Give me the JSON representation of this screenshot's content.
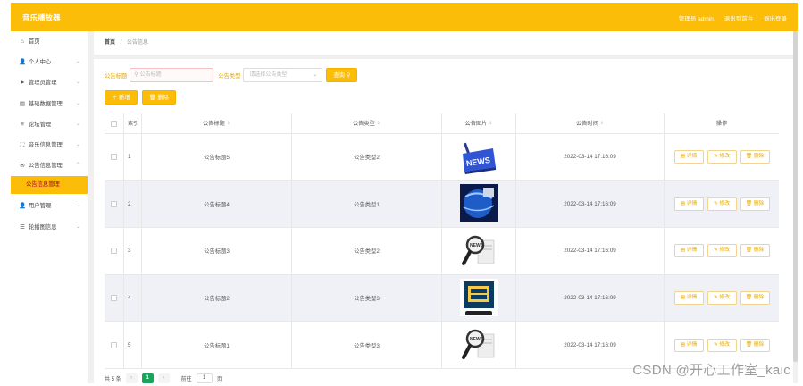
{
  "header": {
    "brand": "音乐播放器",
    "admin_label": "管理员 admin",
    "back_label": "退出到前台",
    "logout_label": "退出登录"
  },
  "sidebar": {
    "items": [
      {
        "label": "首页",
        "icon": "home-icon",
        "glyph": "⌂",
        "chevron": false
      },
      {
        "label": "个人中心",
        "icon": "user-icon",
        "glyph": "👤",
        "chevron": true
      },
      {
        "label": "管理员管理",
        "icon": "send-icon",
        "glyph": "➤",
        "chevron": true
      },
      {
        "label": "基础数据管理",
        "icon": "document-icon",
        "glyph": "▤",
        "chevron": true
      },
      {
        "label": "论坛管理",
        "icon": "menu-lines-icon",
        "glyph": "≡",
        "chevron": true
      },
      {
        "label": "音乐信息管理",
        "icon": "expand-icon",
        "glyph": "⛶",
        "chevron": true
      },
      {
        "label": "公告信息管理",
        "icon": "mail-icon",
        "glyph": "✉",
        "chevron": true,
        "open": true
      },
      {
        "label": "用户管理",
        "icon": "user-icon",
        "glyph": "👤",
        "chevron": true
      },
      {
        "label": "轮播图信息",
        "icon": "list-icon",
        "glyph": "☰",
        "chevron": true
      }
    ],
    "active_sub": "公告信息管理"
  },
  "breadcrumb": {
    "home": "首页",
    "sep": "/",
    "current": "公告信息"
  },
  "search": {
    "title_label": "公告标题",
    "title_placeholder": "公告标题",
    "type_label": "公告类型",
    "type_placeholder": "请选择公告类型",
    "search_button": "查询"
  },
  "actions": {
    "add": "新增",
    "delete": "删除"
  },
  "table": {
    "headers": {
      "index": "索引",
      "title": "公告标题",
      "type": "公告类型",
      "image": "公告图片",
      "time": "公告时间",
      "ops": "操作"
    },
    "rows": [
      {
        "index": "1",
        "title": "公告标题5",
        "type": "公告类型2",
        "image": "news-keyboard-image",
        "time": "2022-03-14 17:16:09"
      },
      {
        "index": "2",
        "title": "公告标题4",
        "type": "公告类型1",
        "image": "globe-blue-image",
        "time": "2022-03-14 17:16:09"
      },
      {
        "index": "3",
        "title": "公告标题3",
        "type": "公告类型2",
        "image": "magnifier-news-image",
        "time": "2022-03-14 17:16:09"
      },
      {
        "index": "4",
        "title": "公告标题2",
        "type": "公告类型3",
        "image": "news-badge-image",
        "time": "2022-03-14 17:16:09"
      },
      {
        "index": "5",
        "title": "公告标题1",
        "type": "公告类型3",
        "image": "magnifier-news-image",
        "time": "2022-03-14 17:16:09"
      }
    ],
    "op_labels": {
      "detail": "详情",
      "edit": "修改",
      "delete": "删除"
    }
  },
  "pagination": {
    "total": "共 5 条",
    "prev": "‹",
    "current": "1",
    "next": "›",
    "goto": "前往",
    "page_value": "1",
    "page_unit": "页"
  },
  "watermark": "CSDN @开心工作室_kaic",
  "colors": {
    "accent": "#fbbd08",
    "stripe": "#f0f1f6",
    "pager_active": "#1aa35a"
  }
}
